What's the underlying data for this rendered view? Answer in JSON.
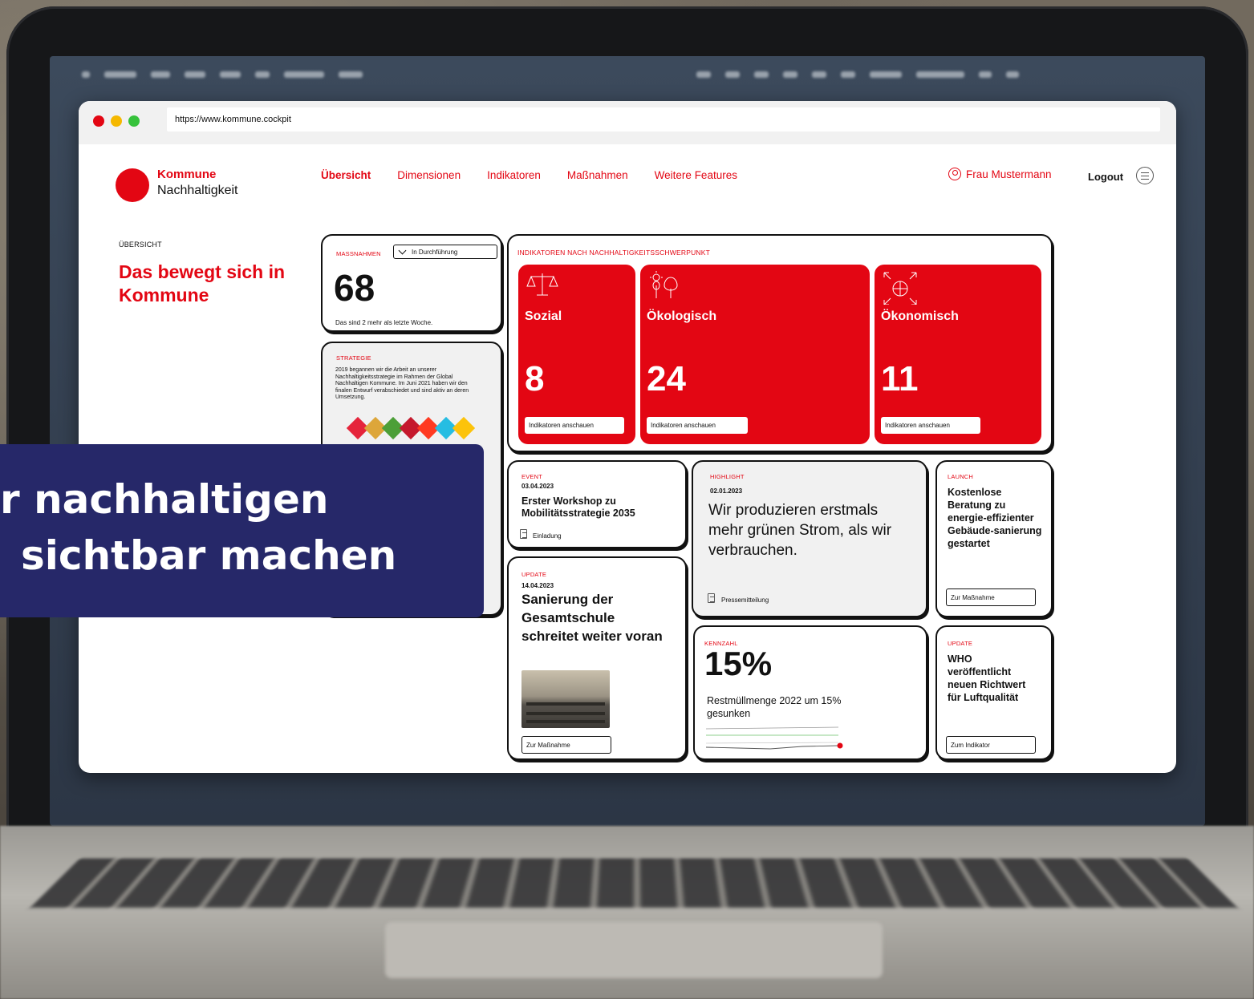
{
  "browser": {
    "url": "https://www.kommune.cockpit"
  },
  "header": {
    "logo_title": "Kommune",
    "logo_subtitle": "Nachhaltigkeit",
    "nav": [
      "Übersicht",
      "Dimensionen",
      "Indikatoren",
      "Maßnahmen",
      "Weitere Features"
    ],
    "user_name": "Frau Mustermann",
    "logout": "Logout"
  },
  "overview": {
    "label": "ÜBERSICHT",
    "title": "Das bewegt sich in Kommune"
  },
  "massnahmen_card": {
    "tag": "MASSNAHMEN",
    "filter": "In Durchführung",
    "value": "68",
    "note": "Das sind 2 mehr als letzte Woche."
  },
  "strategie_card": {
    "tag": "STRATEGIE",
    "text": "2019 begannen wir die Arbeit an unserer Nachhaltigkeitsstrategie im Rahmen der Global Nachhaltigen Kommune. Im Juni 2021 haben wir den finalen Entwurf verabschiedet und sind aktiv an deren Umsetzung."
  },
  "indicators_card": {
    "tag": "INDIKATOREN NACH NACHHALTIGKEITSSCHWERPUNKT",
    "tiles": [
      {
        "name": "Sozial",
        "value": "8",
        "button": "Indikatoren anschauen",
        "icon": "scales-icon"
      },
      {
        "name": "Ökologisch",
        "value": "24",
        "button": "Indikatoren anschauen",
        "icon": "sun-tree-icon"
      },
      {
        "name": "Ökonomisch",
        "value": "11",
        "button": "Indikatoren anschauen",
        "icon": "globe-arrows-icon"
      }
    ]
  },
  "event_card": {
    "tag": "EVENT",
    "date": "03.04.2023",
    "title": "Erster Workshop zu Mobilitätsstrategie 2035",
    "doc": "Einladung"
  },
  "highlight_card": {
    "tag": "HIGHLIGHT",
    "date": "02.01.2023",
    "title": "Wir produzieren erstmals mehr grünen Strom, als wir verbrauchen.",
    "doc": "Pressemitteilung"
  },
  "launch_card": {
    "tag": "LAUNCH",
    "title": "Kostenlose Beratung zu energie-effizienter Gebäude-sanierung gestartet",
    "button": "Zur Maßnahme"
  },
  "update_card": {
    "tag": "UPDATE",
    "date": "14.04.2023",
    "title": "Sanierung der Gesamtschule schreitet weiter voran",
    "button": "Zur Maßnahme"
  },
  "kennzahl_card": {
    "tag": "KENNZAHL",
    "value": "15%",
    "title": "Restmüllmenge 2022 um 15% gesunken"
  },
  "who_card": {
    "tag": "UPDATE",
    "title": "WHO veröffentlicht neuen Richtwert für Luftqualität",
    "button": "Zum Indikator"
  },
  "banner": {
    "line1": "r nachhaltigen",
    "line2": "sichtbar machen"
  },
  "colors": {
    "accent": "#e30613",
    "banner": "#262869"
  }
}
